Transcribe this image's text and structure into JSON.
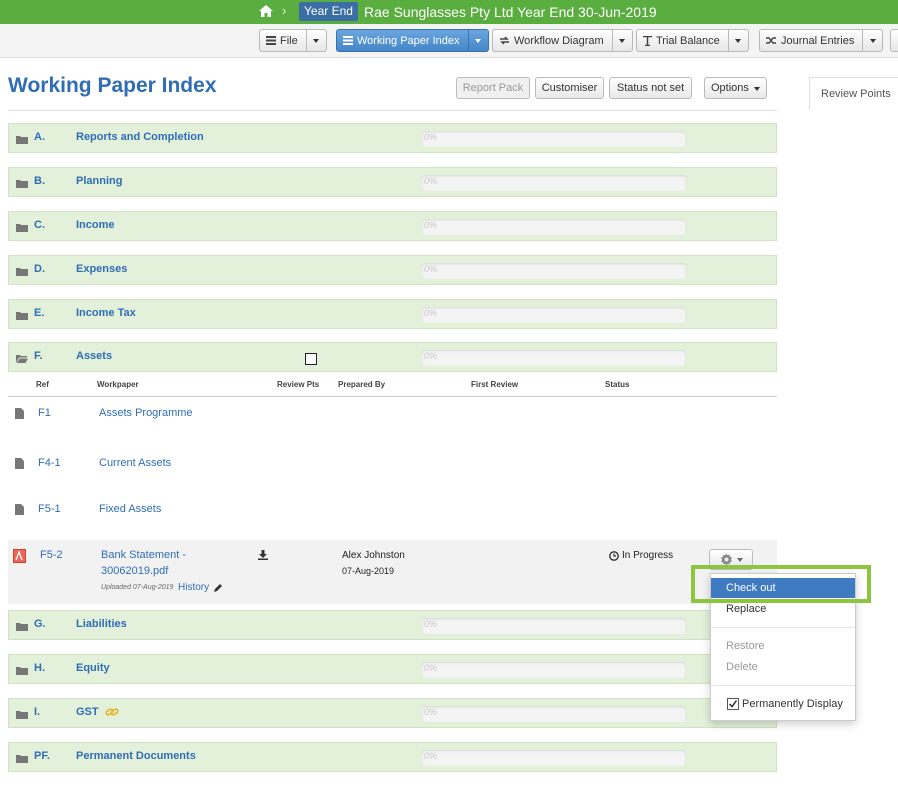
{
  "topbar": {
    "home_icon": "home-icon",
    "separator": "›",
    "badge": "Year End",
    "client": "Rae Sunglasses Pty Ltd  Year End 30-Jun-2019"
  },
  "toolbar": {
    "file": "File",
    "working_paper_index": "Working Paper Index",
    "workflow_diagram": "Workflow Diagram",
    "trial_balance": "Trial Balance",
    "journal_entries": "Journal Entries"
  },
  "page": {
    "title": "Working Paper Index",
    "report_pack": "Report Pack",
    "customiser": "Customiser",
    "status": "Status not set",
    "options": "Options",
    "review_points_tab": "Review Points"
  },
  "progress_text": "0%",
  "sections": [
    {
      "letter": "A.",
      "name": "Reports and Completion"
    },
    {
      "letter": "B.",
      "name": "Planning"
    },
    {
      "letter": "C.",
      "name": "Income"
    },
    {
      "letter": "D.",
      "name": "Expenses"
    },
    {
      "letter": "E.",
      "name": "Income Tax"
    },
    {
      "letter": "F.",
      "name": "Assets"
    },
    {
      "letter": "G.",
      "name": "Liabilities"
    },
    {
      "letter": "H.",
      "name": "Equity"
    },
    {
      "letter": "I.",
      "name": "GST"
    },
    {
      "letter": "PF.",
      "name": "Permanent Documents"
    }
  ],
  "columns": {
    "ref": "Ref",
    "workpaper": "Workpaper",
    "review_pts": "Review Pts",
    "prepared_by": "Prepared By",
    "first_review": "First Review",
    "status": "Status"
  },
  "workpapers": [
    {
      "ref": "F1",
      "name": "Assets Programme"
    },
    {
      "ref": "F4-1",
      "name": "Current Assets"
    },
    {
      "ref": "F5-1",
      "name": "Fixed Assets"
    }
  ],
  "bank_statement": {
    "ref": "F5-2",
    "name_line1": "Bank Statement -",
    "name_line2": "30062019.pdf",
    "uploaded": "Uploaded 07-Aug-2019",
    "history": "History",
    "prepared_by": "Alex Johnston",
    "prepared_date": "07-Aug-2019",
    "status": "In Progress"
  },
  "menu": {
    "check_out": "Check out",
    "replace": "Replace",
    "restore": "Restore",
    "delete": "Delete",
    "permanently_display": "Permanently Display"
  },
  "colors": {
    "brand_green": "#5aad3f",
    "section_bg": "#e3f1da",
    "link_blue": "#2f6db5",
    "highlight": "#8cc63f"
  }
}
